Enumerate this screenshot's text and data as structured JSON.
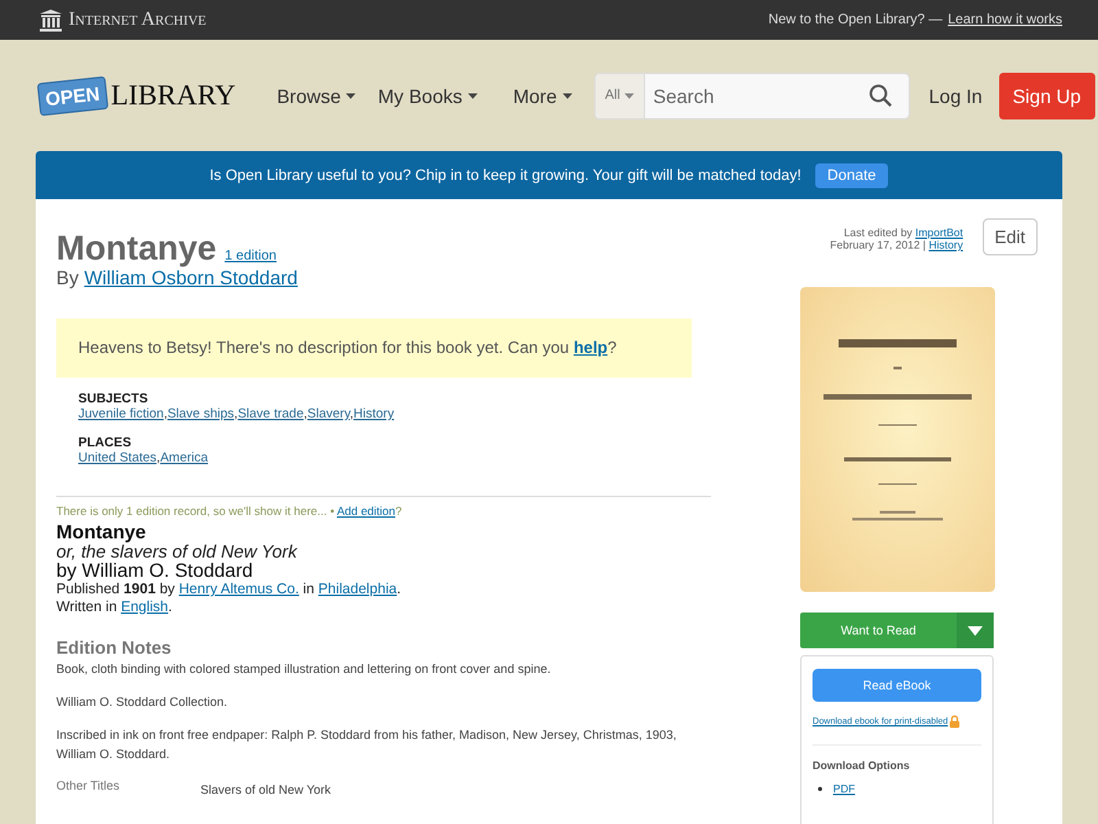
{
  "topbar": {
    "brand": "Internet Archive",
    "prompt": "New to the Open Library? —",
    "link": "Learn how it works"
  },
  "header": {
    "logo_badge": "OPEN",
    "logo_text": "LIBRARY",
    "nav": [
      {
        "label": "Browse"
      },
      {
        "label": "My Books"
      },
      {
        "label": "More"
      }
    ],
    "search": {
      "scope": "All",
      "placeholder": "Search"
    },
    "login": "Log In",
    "signup": "Sign Up"
  },
  "banner": {
    "message": "Is Open Library useful to you? Chip in to keep it growing. Your gift will be matched today!",
    "button": "Donate"
  },
  "work": {
    "title": "Montanye",
    "editions_link": "1 edition",
    "by": "By",
    "author": "William Osborn Stoddard",
    "edit_info": {
      "prefix": "Last edited by",
      "editor": "ImportBot",
      "date": "February 17, 2012 |",
      "history": "History"
    },
    "edit_button": "Edit",
    "notice": {
      "text": "Heavens to Betsy! There's no description for this book yet. Can you",
      "link": "help",
      "end": "?"
    },
    "facets": [
      {
        "heading": "SUBJECTS",
        "separator": ",",
        "links": [
          "Juvenile fiction",
          "Slave ships",
          "Slave trade",
          "Slavery",
          "History"
        ]
      },
      {
        "heading": "PLACES",
        "separator": ",",
        "links": [
          "United States",
          "America"
        ]
      }
    ]
  },
  "edition": {
    "note": "There is only 1 edition record, so we'll show it here...  •",
    "add_link": "Add edition",
    "note_end": "?",
    "title": "Montanye",
    "subtitle": "or, the slavers of old New York",
    "byline": "by William O. Stoddard",
    "published": {
      "before": "Published **1901** by",
      "publisher": "Henry Altemus Co.",
      "middle": "in",
      "place": "Philadelphia",
      "end": "."
    },
    "written": {
      "before": "Written in",
      "language": "English",
      "end": "."
    },
    "notes_heading": "Edition Notes",
    "notes": [
      "Book, cloth binding with colored stamped illustration and lettering on front cover and spine.",
      "William O. Stoddard Collection.",
      "Inscribed in ink on front free endpaper: Ralph P. Stoddard from his father, Madison, New Jersey, Christmas, 1903, William O. Stoddard."
    ],
    "other_titles": {
      "label": "Other Titles",
      "value": "Slavers of old New York"
    }
  },
  "sidebar": {
    "cover": {
      "kind": "picture"
    },
    "want_to_read": "Want to Read",
    "read_ebook": "Read eBook",
    "download_link": "Download ebook for print-disabled",
    "options_heading": "Download Options",
    "options": [
      "PDF"
    ]
  }
}
